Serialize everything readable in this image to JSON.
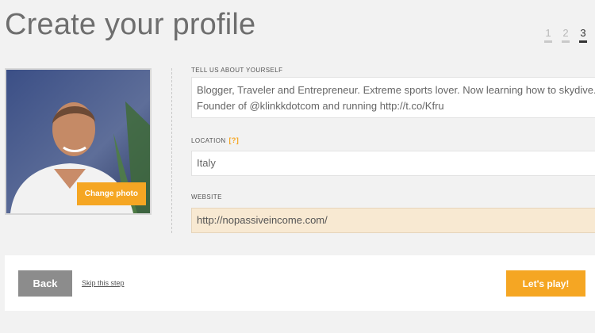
{
  "page": {
    "title": "Create your profile"
  },
  "steps": [
    "1",
    "2",
    "3"
  ],
  "profile": {
    "change_photo_label": "Change photo",
    "bio_label": "TELL US ABOUT YOURSELF",
    "bio_value": "Blogger, Traveler and Entrepreneur. Extreme sports lover. Now learning how to skydive. Founder of @klinkkdotcom and running http://t.co/Kfru",
    "location_label": "LOCATION",
    "location_help": "[?]",
    "location_value": "Italy",
    "website_label": "WEBSITE",
    "website_value": "http://nopassiveincome.com/"
  },
  "footer": {
    "back_label": "Back",
    "skip_label": "Skip this step",
    "play_label": "Let's play!"
  },
  "colors": {
    "accent": "#f5a623",
    "back": "#8c8c8c",
    "website_bg": "#f8e9d2"
  },
  "icons": {
    "photo": "profile-photo"
  }
}
